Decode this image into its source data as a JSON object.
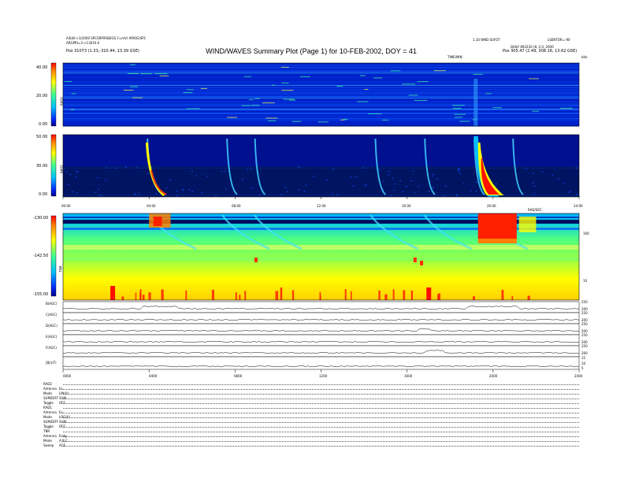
{
  "header": {
    "title": "WIND/WAVES Summary Plot (Page 1) for 10-FEB-2002, DOY = 41",
    "left_line1": "A3LW->1(2000 SPCSRP/RSB/GS Y=mV/ ARRIG)SPC",
    "left_line2": "ARGPRI=3->13016.0",
    "left_pos": "Pos   31073 (1.33,-310.44, 13.39 GSE)",
    "right_line1": "1.10 WND SUFOT",
    "right_line2": "LSENTOR=-90",
    "right_line3": "DAILY  893230 (8, 2.0, 2000",
    "right_pos": "Pos   305.47 (2.49, 308.16, 13.62 GSE)",
    "time_label": "TIME/MIN",
    "time_label2": "RAD/SEC",
    "right_unit": "kHz"
  },
  "panels": {
    "rad2": {
      "label": "RAD2",
      "ticks": [
        "40.00",
        "20.00",
        "0.00"
      ]
    },
    "rad1": {
      "label": "RAD1",
      "ticks": [
        "50.00",
        "30.00",
        "0.00"
      ]
    },
    "tnr": {
      "label": "TNR",
      "ticks": [
        "-130.00",
        "-142.50",
        "-155.00"
      ],
      "right_ticks": [
        "100",
        "10"
      ]
    }
  },
  "time_axis": [
    "00:00",
    "04:00",
    "08:00",
    "12:00",
    "16:00",
    "20:00",
    "24:00"
  ],
  "bottom_time_axis": [
    "0000",
    "0400",
    "0800",
    "1200",
    "1600",
    "2000",
    "2400"
  ],
  "line_panels": [
    {
      "label": "B(AGC)",
      "right_ticks": [
        "250",
        "200"
      ]
    },
    {
      "label": "C(AGC)",
      "right_ticks": [
        "250",
        "200"
      ]
    },
    {
      "label": "D(AGC)",
      "right_ticks": [
        "250",
        "200"
      ]
    },
    {
      "label": "E(AGC)",
      "right_ticks": [
        "250",
        "200"
      ]
    },
    {
      "label": "F(AGC)",
      "right_ticks": [
        "250",
        "200"
      ]
    },
    {
      "label": "|B|(nT)",
      "right_ticks": [
        "15",
        "10",
        "5"
      ]
    }
  ],
  "footer": [
    {
      "k": "RAD2",
      "v": ""
    },
    {
      "k": "Antenna",
      "v": "Ex"
    },
    {
      "k": "Mode",
      "v": "LIN(0)"
    },
    {
      "k": "SUM/DIFF",
      "v": "SUM"
    },
    {
      "k": "Toggle",
      "v": "OFF"
    },
    {
      "k": "RAD1",
      "v": ""
    },
    {
      "k": "Antenna",
      "v": "Ex"
    },
    {
      "k": "Mode",
      "v": "LOG(0)"
    },
    {
      "k": "SUM/DIFF",
      "v": "SUM"
    },
    {
      "k": "Toggle",
      "v": "OFF"
    },
    {
      "k": "TNR",
      "v": ""
    },
    {
      "k": "Antenna",
      "v": "Exdy"
    },
    {
      "k": "Mode",
      "v": "A,B,C"
    },
    {
      "k": "Sweep",
      "v": "ACE"
    }
  ],
  "chart_data": {
    "type": "heatmap",
    "title": "WIND/WAVES Summary Plot (Page 1) for 10-FEB-2002, DOY = 41",
    "x_units": "hours UT",
    "xlim": [
      0,
      24
    ],
    "colormap": [
      "#00008f",
      "#0030ff",
      "#00c0ff",
      "#40ff90",
      "#ffff00",
      "#ff8000",
      "#ff0000",
      "#ffffff"
    ],
    "panels": [
      {
        "name": "RAD2",
        "ylim": [
          0,
          40
        ],
        "ticks": [
          0,
          20,
          40
        ],
        "background": "dark-blue"
      },
      {
        "name": "RAD1",
        "ylim": [
          0,
          50
        ],
        "ticks": [
          0,
          30,
          50
        ],
        "background": "dark-blue"
      },
      {
        "name": "TNR",
        "ylim": [
          -155,
          -130
        ],
        "ticks": [
          -155,
          -142.5,
          -130
        ],
        "background": "green-yellow"
      }
    ],
    "type_iii_bursts_hours": [
      4.0,
      7.7,
      9.0,
      14.6,
      16.9,
      19.2,
      21.0
    ],
    "major_burst": {
      "start_hour": 19.3,
      "end_hour": 21.2,
      "panel": "RAD1"
    }
  }
}
